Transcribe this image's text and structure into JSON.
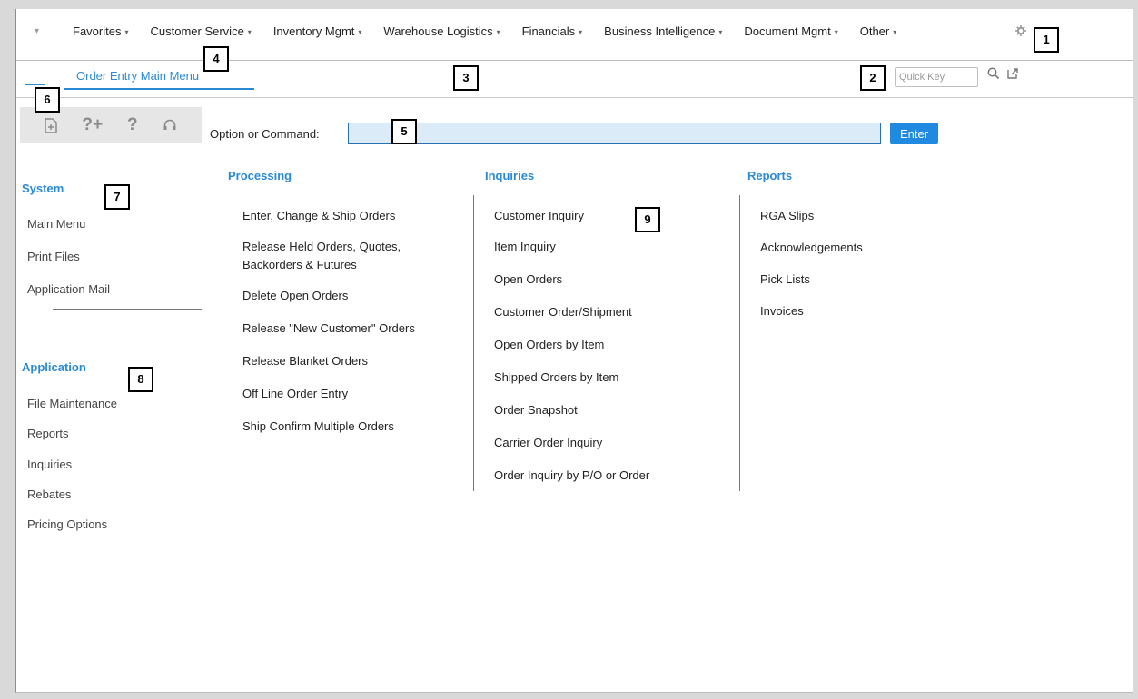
{
  "nav": {
    "items": [
      {
        "label": "Favorites"
      },
      {
        "label": "Customer Service"
      },
      {
        "label": "Inventory Mgmt"
      },
      {
        "label": "Warehouse Logistics"
      },
      {
        "label": "Financials"
      },
      {
        "label": "Business Intelligence"
      },
      {
        "label": "Document Mgmt"
      },
      {
        "label": "Other"
      }
    ],
    "dropdown_glyph": "▾",
    "caret_glyph": "▾"
  },
  "tab": {
    "label": "Order Entry Main Menu"
  },
  "quick_key": {
    "placeholder": "Quick Key",
    "value": ""
  },
  "command": {
    "label": "Option or Command:",
    "value": "",
    "enter_label": "Enter"
  },
  "sidebar": {
    "toolbar_glyphs": {
      "help_plus": "?+",
      "help": "?"
    },
    "system": {
      "title": "System",
      "items": [
        "Main Menu",
        "Print Files",
        "Application Mail"
      ]
    },
    "application": {
      "title": "Application",
      "items": [
        "File Maintenance",
        "Reports",
        "Inquiries",
        "Rebates",
        "Pricing Options"
      ]
    }
  },
  "columns": {
    "processing": {
      "title": "Processing",
      "items": [
        "Enter, Change & Ship Orders",
        "Release Held Orders, Quotes,",
        "Backorders & Futures",
        "Delete Open Orders",
        "Release \"New Customer\" Orders",
        "Release Blanket Orders",
        "Off Line Order Entry",
        "Ship Confirm Multiple Orders"
      ]
    },
    "inquiries": {
      "title": "Inquiries",
      "items": [
        "Customer Inquiry",
        "Item Inquiry",
        "Open Orders",
        "Customer Order/Shipment",
        "Open Orders by Item",
        "Shipped Orders by Item",
        "Order Snapshot",
        "Carrier Order Inquiry",
        "Order Inquiry by P/O or Order"
      ]
    },
    "reports": {
      "title": "Reports",
      "items": [
        "RGA Slips",
        "Acknowledgements",
        "Pick Lists",
        "Invoices"
      ]
    }
  },
  "callouts": [
    "1",
    "2",
    "3",
    "4",
    "5",
    "6",
    "7",
    "8",
    "9"
  ],
  "colors": {
    "accent": "#2a8ad6",
    "enter_button": "#1f8ae0",
    "command_input_bg": "#dcebf8"
  }
}
